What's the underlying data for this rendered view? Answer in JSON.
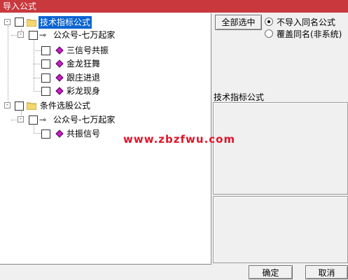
{
  "window": {
    "title": "导入公式"
  },
  "tree": {
    "groups": [
      {
        "label": "技术指标公式",
        "expander": "-",
        "owner": {
          "label": "公众号-七万起家",
          "expander": "-",
          "items": [
            "三信号共振",
            "金龙狂舞",
            "跟庄进退",
            "彩龙现身"
          ]
        }
      },
      {
        "label": "条件选股公式",
        "expander": "-",
        "owner": {
          "label": "公众号-七万起家",
          "expander": "-",
          "items": [
            "共振信号"
          ]
        }
      }
    ]
  },
  "options": {
    "select_all_label": "全部选中",
    "radio_no_import": "不导入同名公式",
    "radio_overwrite": "覆盖同名(非系统)",
    "selected": "no_import"
  },
  "info": {
    "panel_title": "技术指标公式"
  },
  "watermark": "www.zbzfwu.com",
  "footer": {
    "ok_label": "确定",
    "cancel_label": "取消"
  },
  "icons": {
    "folder": "folder-icon",
    "key": "key-icon",
    "formula": "formula-icon"
  },
  "colors": {
    "title_bar": "#c8383c",
    "selection": "#0a64d2",
    "watermark": "#e0142a",
    "formula_gem": "#c020c0"
  }
}
